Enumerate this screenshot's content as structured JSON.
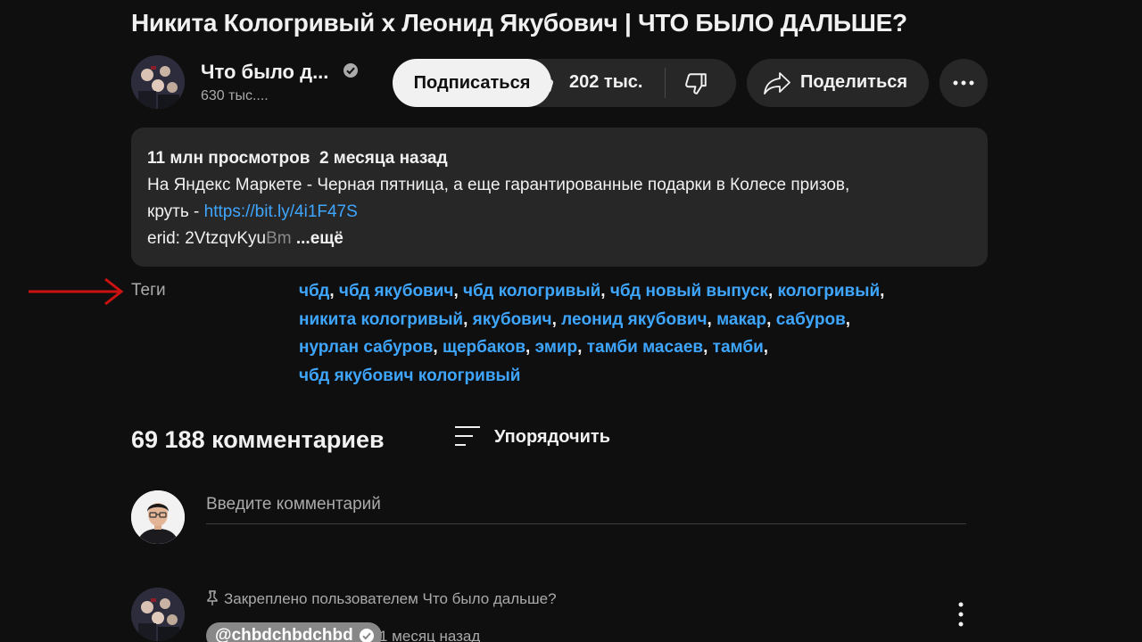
{
  "video": {
    "title": "Никита Кологривый x Леонид Якубович | ЧТО БЫЛО ДАЛЬШЕ?"
  },
  "channel": {
    "name": "Что было д...",
    "subscribers": "630 тыс....",
    "subscribe_label": "Подписаться"
  },
  "actions": {
    "likes": "202 тыс.",
    "share_label": "Поделиться"
  },
  "description": {
    "views": "11 млн просмотров",
    "date": "2 месяца назад",
    "line1": "На Яндекс Маркете - Черная пятница, а еще гарантированные подарки в Колесе призов,",
    "line2_prefix": "круть - ",
    "link": "https://bit.ly/4i1F47S",
    "erid_prefix": "erid: 2VtzqvKyu",
    "erid_fade": "Bm",
    "more_label": "...ещё"
  },
  "tags": {
    "label": "Теги",
    "items": [
      "чбд",
      "чбд якубович",
      "чбд кологривый",
      "чбд новый выпуск",
      "кологривый",
      "никита кологривый",
      "якубович",
      "леонид якубович",
      "макар",
      "сабуров",
      "нурлан сабуров",
      "щербаков",
      "эмир",
      "тамби масаев",
      "тамби",
      "чбд якубович кологривый"
    ]
  },
  "comments": {
    "count_label": "69 188 комментариев",
    "sort_label": "Упорядочить",
    "input_placeholder": "Введите комментарий",
    "pinned": {
      "pinned_by": "Закреплено пользователем Что было дальше?",
      "author": "@chbdchbdchbd",
      "time": "1 месяц назад"
    }
  },
  "colors": {
    "background": "#0f0f0f",
    "pill": "#272727",
    "link": "#3ea6ff",
    "arrow": "#cc1111"
  },
  "icons": [
    "verified-icon",
    "like-icon",
    "dislike-icon",
    "share-icon",
    "more-icon",
    "sort-icon",
    "pin-icon",
    "kebab-icon",
    "red-arrow"
  ]
}
